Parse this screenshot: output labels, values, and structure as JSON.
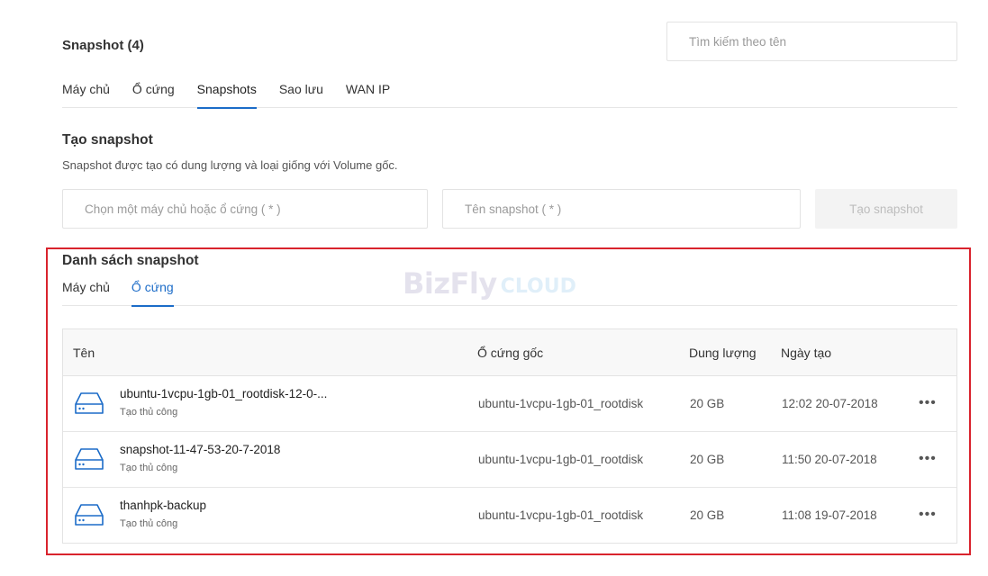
{
  "header": {
    "title": "Snapshot (4)",
    "search_placeholder": "Tìm kiếm theo tên"
  },
  "main_tabs": [
    {
      "label": "Máy chủ"
    },
    {
      "label": "Ổ cứng"
    },
    {
      "label": "Snapshots"
    },
    {
      "label": "Sao lưu"
    },
    {
      "label": "WAN IP"
    }
  ],
  "create": {
    "title": "Tạo snapshot",
    "description": "Snapshot được tạo có dung lượng và loại giống với Volume gốc.",
    "source_placeholder": "Chọn một máy chủ hoặc ổ cứng ( * )",
    "name_placeholder": "Tên snapshot ( * )",
    "button_label": "Tạo snapshot"
  },
  "list": {
    "title": "Danh sách snapshot",
    "tabs": [
      {
        "label": "Máy chủ"
      },
      {
        "label": "Ổ cứng"
      }
    ],
    "columns": {
      "name": "Tên",
      "source": "Ổ cứng gốc",
      "size": "Dung lượng",
      "created": "Ngày tạo"
    },
    "rows": [
      {
        "name": "ubuntu-1vcpu-1gb-01_rootdisk-12-0-...",
        "type": "Tạo thủ công",
        "source": "ubuntu-1vcpu-1gb-01_rootdisk",
        "size": "20 GB",
        "created": "12:02 20-07-2018"
      },
      {
        "name": "snapshot-11-47-53-20-7-2018",
        "type": "Tạo thủ công",
        "source": "ubuntu-1vcpu-1gb-01_rootdisk",
        "size": "20 GB",
        "created": "11:50 20-07-2018"
      },
      {
        "name": "thanhpk-backup",
        "type": "Tạo thủ công",
        "source": "ubuntu-1vcpu-1gb-01_rootdisk",
        "size": "20 GB",
        "created": "11:08 19-07-2018"
      }
    ],
    "more_glyph": "•••"
  },
  "watermark": {
    "main": "BizFly",
    "sub": "CLOUD"
  },
  "colors": {
    "accent": "#1c6cc8",
    "highlight": "#d9232d"
  },
  "icons": {
    "disk": "hard-disk-icon",
    "more": "more-horizontal-icon"
  }
}
